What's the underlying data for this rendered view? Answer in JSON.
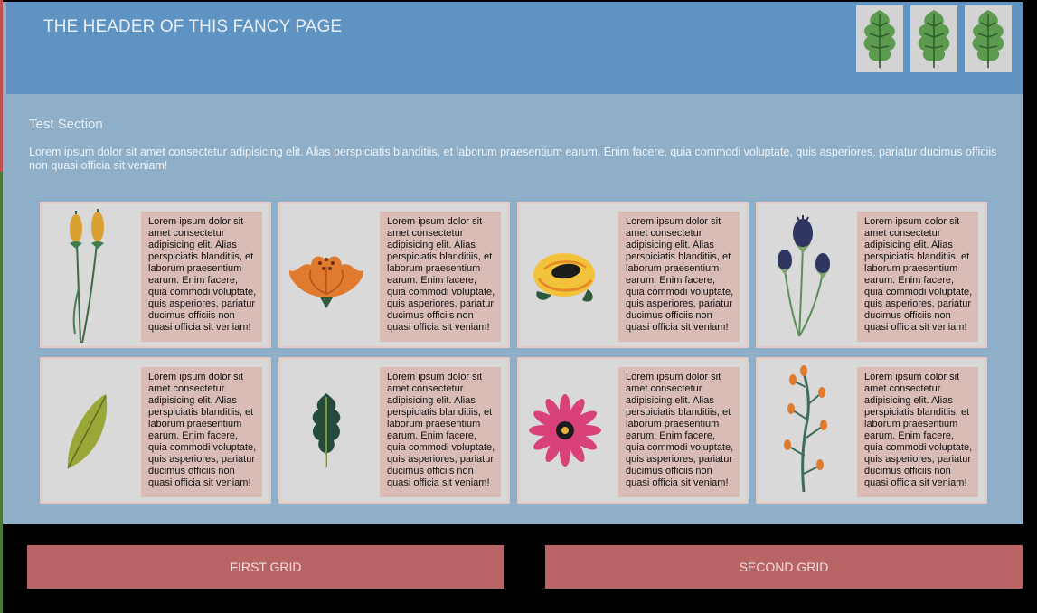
{
  "header": {
    "title": "THE HEADER OF THIS FANCY PAGE"
  },
  "section": {
    "title": "Test Section",
    "text": "Lorem ipsum dolor sit amet consectetur adipisicing elit. Alias perspiciatis blanditiis, et laborum praesentium earum. Enim facere, quia commodi voluptate, quis asperiores, pariatur ducimus officiis non quasi officia sit veniam!"
  },
  "cards": [
    {
      "icon": "cattail-icon",
      "text": "Lorem ipsum dolor sit amet consectetur adipisicing elit. Alias perspiciatis blanditiis, et laborum praesentium earum. Enim facere, quia commodi voluptate, quis asperiores, pariatur ducimus officiis non quasi officia sit veniam!"
    },
    {
      "icon": "orange-flower-icon",
      "text": "Lorem ipsum dolor sit amet consectetur adipisicing elit. Alias perspiciatis blanditiis, et laborum praesentium earum. Enim facere, quia commodi voluptate, quis asperiores, pariatur ducimus officiis non quasi officia sit veniam!"
    },
    {
      "icon": "yellow-rose-icon",
      "text": "Lorem ipsum dolor sit amet consectetur adipisicing elit. Alias perspiciatis blanditiis, et laborum praesentium earum. Enim facere, quia commodi voluptate, quis asperiores, pariatur ducimus officiis non quasi officia sit veniam!"
    },
    {
      "icon": "thistle-icon",
      "text": "Lorem ipsum dolor sit amet consectetur adipisicing elit. Alias perspiciatis blanditiis, et laborum praesentium earum. Enim facere, quia commodi voluptate, quis asperiores, pariatur ducimus officiis non quasi officia sit veniam!"
    },
    {
      "icon": "green-leaf-icon",
      "text": "Lorem ipsum dolor sit amet consectetur adipisicing elit. Alias perspiciatis blanditiis, et laborum praesentium earum. Enim facere, quia commodi voluptate, quis asperiores, pariatur ducimus officiis non quasi officia sit veniam!"
    },
    {
      "icon": "oak-leaf-icon",
      "text": "Lorem ipsum dolor sit amet consectetur adipisicing elit. Alias perspiciatis blanditiis, et laborum praesentium earum. Enim facere, quia commodi voluptate, quis asperiores, pariatur ducimus officiis non quasi officia sit veniam!"
    },
    {
      "icon": "pink-daisy-icon",
      "text": "Lorem ipsum dolor sit amet consectetur adipisicing elit. Alias perspiciatis blanditiis, et laborum praesentium earum. Enim facere, quia commodi voluptate, quis asperiores, pariatur ducimus officiis non quasi officia sit veniam!"
    },
    {
      "icon": "berry-branch-icon",
      "text": "Lorem ipsum dolor sit amet consectetur adipisicing elit. Alias perspiciatis blanditiis, et laborum praesentium earum. Enim facere, quia commodi voluptate, quis asperiores, pariatur ducimus officiis non quasi officia sit veniam!"
    }
  ],
  "buttons": {
    "first": "FIRST GRID",
    "second": "SECOND GRID"
  },
  "colors": {
    "header_bg": "#5f93c1",
    "section_bg": "#8fafc9",
    "card_bg": "#d9d9d9",
    "card_text_bg": "#d9bcb5",
    "button_bg": "#b96464"
  }
}
